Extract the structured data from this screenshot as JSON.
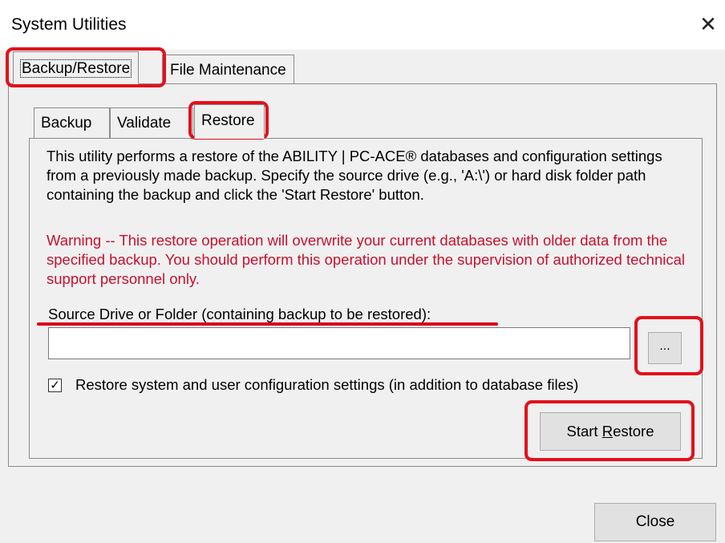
{
  "window": {
    "title": "System Utilities",
    "close_glyph": "✕"
  },
  "outer_tabs": [
    "Backup/Restore",
    "File Maintenance"
  ],
  "inner_tabs": [
    "Backup",
    "Validate",
    "Restore"
  ],
  "restore": {
    "description": "This utility performs a restore of the ABILITY | PC-ACE® databases and configuration settings from a previously made backup. Specify the source drive (e.g., 'A:\\') or hard disk folder path containing the backup and click the 'Start Restore' button.",
    "warning": "Warning -- This restore operation will overwrite your current databases with older data from the specified backup. You should perform this operation under the supervision of authorized technical support personnel only.",
    "source_label": "Source Drive or Folder (containing backup to be restored):",
    "source_value": "",
    "browse_label": "...",
    "restore_config_label": "Restore system and user configuration settings (in addition to database files)",
    "restore_config_checked": true,
    "start_button": {
      "prefix": "Start ",
      "accel": "R",
      "rest": "estore"
    }
  },
  "footer": {
    "close_label": "Close"
  },
  "colors": {
    "highlight": "#e3101a",
    "warning_text": "#c8102e"
  }
}
